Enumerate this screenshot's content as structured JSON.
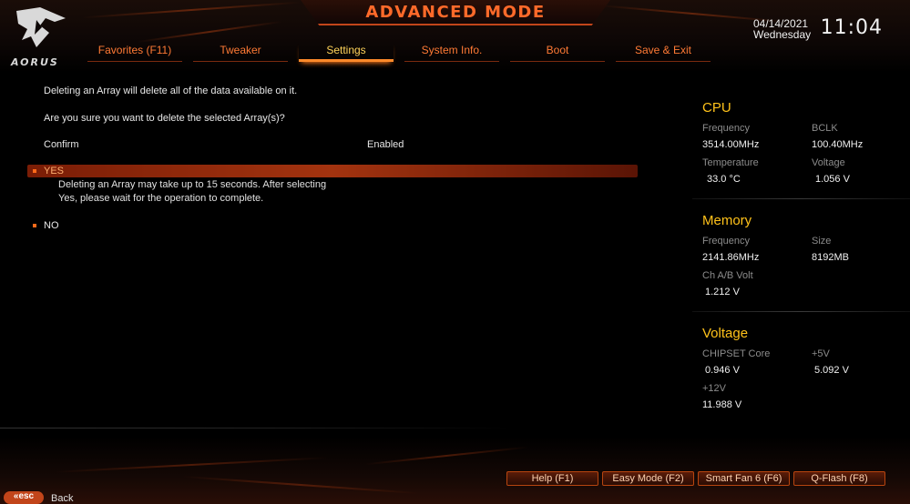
{
  "header": {
    "title": "ADVANCED MODE",
    "brand": "AORUS",
    "date": "04/14/2021",
    "day": "Wednesday",
    "time": "11:04"
  },
  "tabs": [
    {
      "label": "Favorites (F11)",
      "active": false
    },
    {
      "label": "Tweaker",
      "active": false
    },
    {
      "label": "Settings",
      "active": true
    },
    {
      "label": "System Info.",
      "active": false
    },
    {
      "label": "Boot",
      "active": false
    },
    {
      "label": "Save & Exit",
      "active": false
    }
  ],
  "main": {
    "line1": "Deleting an Array will delete all of the data available on it.",
    "line2": "Are you sure you want to delete the selected Array(s)?",
    "confirm": {
      "label": "Confirm",
      "value": "Enabled"
    },
    "options": [
      {
        "label": "YES",
        "selected": true
      },
      {
        "label": "NO",
        "selected": false
      }
    ],
    "help_line1": "Deleting an Array may take up to 15 seconds. After selecting",
    "help_line2": "Yes, please wait for the operation to complete."
  },
  "info": {
    "cpu": {
      "title": "CPU",
      "freq_label": "Frequency",
      "freq_value": "3514.00MHz",
      "bclk_label": "BCLK",
      "bclk_value": "100.40MHz",
      "temp_label": "Temperature",
      "temp_value": "33.0 °C",
      "volt_label": "Voltage",
      "volt_value": "1.056 V"
    },
    "memory": {
      "title": "Memory",
      "freq_label": "Frequency",
      "freq_value": "2141.86MHz",
      "size_label": "Size",
      "size_value": "8192MB",
      "chvolt_label": "Ch A/B Volt",
      "chvolt_value": "1.212 V"
    },
    "voltage": {
      "title": "Voltage",
      "chipset_label": "CHIPSET Core",
      "chipset_value": "0.946 V",
      "v5_label": "+5V",
      "v5_value": "5.092 V",
      "v12_label": "+12V",
      "v12_value": "11.988 V"
    }
  },
  "footer": {
    "buttons": [
      "Help (F1)",
      "Easy Mode (F2)",
      "Smart Fan 6 (F6)",
      "Q-Flash (F8)"
    ],
    "esc_key": "esc",
    "esc_label": "Back"
  },
  "colors": {
    "accent": "#ff6a2a",
    "active_tab": "#ffd35a",
    "section_title": "#ffc21a",
    "selection": "#a3330f"
  }
}
